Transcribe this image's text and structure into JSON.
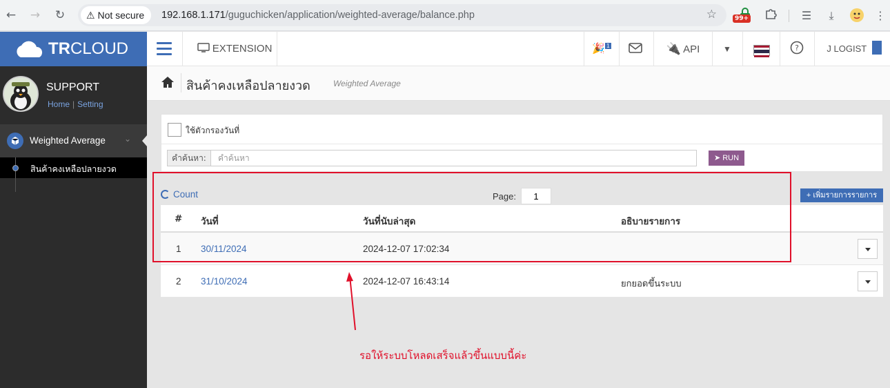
{
  "browser": {
    "security_label": "Not secure",
    "url_host": "192.168.1.171",
    "url_path": "/guguchicken/application/weighted-average/balance.php",
    "ext_badge": "99+"
  },
  "brand": {
    "logo_bold": "TR",
    "logo_rest": "CLOUD",
    "color": "#3e6db5"
  },
  "topbar": {
    "extension_label": "EXTENSION",
    "api_label": "API",
    "user_label": "J LOGIST",
    "notify_count": "1"
  },
  "sidebar": {
    "title": "SUPPORT",
    "link_home": "Home",
    "link_sep": "|",
    "link_setting": "Setting",
    "menu_label": "Weighted Average",
    "submenu_label": "สินค้าคงเหลือปลายงวด"
  },
  "page": {
    "title": "สินค้าคงเหลือปลายงวด",
    "subtitle": "Weighted Average"
  },
  "filter": {
    "date_filter_label": "ใช้ตัวกรองวันที่",
    "search_label": "คำค้นหา:",
    "search_placeholder": "คำค้นหา",
    "run_label": "RUN"
  },
  "listing": {
    "count_label": "Count",
    "page_label": "Page:",
    "page_value": "1",
    "add_label": "+ เพิ่มรายการรายการ",
    "columns": [
      "#",
      "วันที่",
      "วันที่นับล่าสุด",
      "อธิบายรายการ"
    ],
    "rows": [
      {
        "no": "1",
        "date": "30/11/2024",
        "counted_at": "2024-12-07  17:02:34",
        "desc": ""
      },
      {
        "no": "2",
        "date": "31/10/2024",
        "counted_at": "2024-12-07  16:43:14",
        "desc": "ยกยอดขึ้นระบบ"
      }
    ]
  },
  "annotation": {
    "text": "รอให้ระบบโหลดเสร็จแล้วขึ้นแบบนี้ค่ะ",
    "color": "#e0102a"
  }
}
